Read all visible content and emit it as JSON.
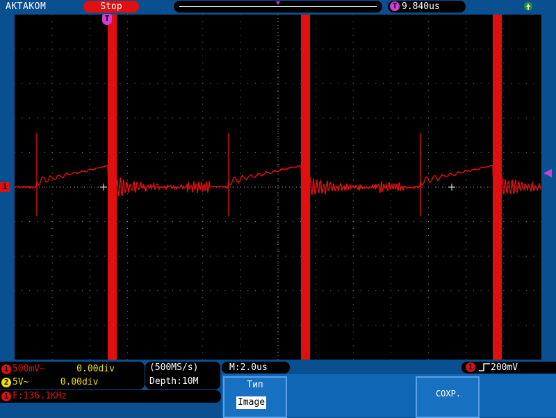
{
  "topbar": {
    "brand": "AKTAKOM",
    "status": "Stop",
    "trigger_position": "9.840us"
  },
  "markers": {
    "trigger": "T",
    "channel1": "1"
  },
  "channels": {
    "ch1": {
      "number": "1",
      "scale": "500mV~",
      "offset": "0.00div",
      "color": "#e01010"
    },
    "ch2": {
      "number": "2",
      "scale": "5V~",
      "offset": "0.00div",
      "color": "#f0e000"
    }
  },
  "acquisition": {
    "sample_rate": "(500MS/s)",
    "depth": "Depth:10M"
  },
  "measurement": {
    "channel": "1",
    "frequency": "F:136.1KHz"
  },
  "timebase": "M:2.0us",
  "trigger": {
    "channel": "1",
    "level": "200mV"
  },
  "menu": {
    "type_label": "Тип",
    "type_value": "Image",
    "save_label": "СОХР."
  },
  "colors": {
    "trace": "#e01010",
    "trigger": "#d23cd2",
    "background": "#0a4f8f"
  }
}
